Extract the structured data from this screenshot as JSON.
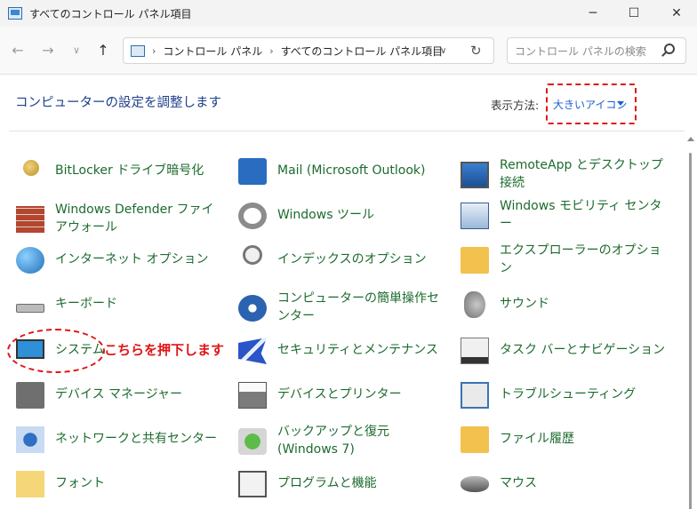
{
  "window": {
    "title": "すべてのコントロール パネル項目",
    "controls": {
      "minimize": "─",
      "maximize": "☐",
      "close": "✕"
    }
  },
  "address_bar": {
    "crumbs": [
      "コントロール パネル",
      "すべてのコントロール パネル項目"
    ],
    "search_placeholder": "コントロール パネルの検索"
  },
  "heading": {
    "title": "コンピューターの設定を調整します",
    "view_label": "表示方法:",
    "view_value": "大きいアイコン"
  },
  "items": [
    {
      "label": "BitLocker ドライブ暗号化",
      "icon": "bitlocker-key-icon"
    },
    {
      "label": "Mail (Microsoft Outlook)",
      "icon": "mail-icon"
    },
    {
      "label": "RemoteApp とデスクトップ接続",
      "icon": "remoteapp-icon"
    },
    {
      "label": "Windows Defender ファイアウォール",
      "icon": "firewall-icon"
    },
    {
      "label": "Windows ツール",
      "icon": "gear-tools-icon"
    },
    {
      "label": "Windows モビリティ センター",
      "icon": "mobility-center-icon"
    },
    {
      "label": "インターネット オプション",
      "icon": "internet-options-icon"
    },
    {
      "label": "インデックスのオプション",
      "icon": "indexing-icon"
    },
    {
      "label": "エクスプローラーのオプション",
      "icon": "folder-options-icon"
    },
    {
      "label": "キーボード",
      "icon": "keyboard-icon"
    },
    {
      "label": "コンピューターの簡単操作センター",
      "icon": "ease-of-access-icon"
    },
    {
      "label": "サウンド",
      "icon": "sound-icon"
    },
    {
      "label": "システム",
      "icon": "system-monitor-icon"
    },
    {
      "label": "セキュリティとメンテナンス",
      "icon": "security-flag-icon"
    },
    {
      "label": "タスク バーとナビゲーション",
      "icon": "taskbar-icon"
    },
    {
      "label": "デバイス マネージャー",
      "icon": "device-manager-icon"
    },
    {
      "label": "デバイスとプリンター",
      "icon": "printer-icon"
    },
    {
      "label": "トラブルシューティング",
      "icon": "troubleshooting-icon"
    },
    {
      "label": "ネットワークと共有センター",
      "icon": "network-icon"
    },
    {
      "label": "バックアップと復元 (Windows 7)",
      "icon": "backup-icon"
    },
    {
      "label": "ファイル履歴",
      "icon": "file-history-icon"
    },
    {
      "label": "フォント",
      "icon": "font-icon"
    },
    {
      "label": "プログラムと機能",
      "icon": "programs-icon"
    },
    {
      "label": "マウス",
      "icon": "mouse-icon"
    }
  ],
  "annotation": {
    "text": "こちらを押下します",
    "color": "#e01414"
  }
}
